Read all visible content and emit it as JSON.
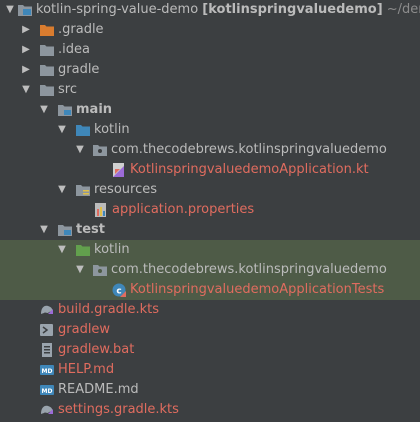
{
  "project": {
    "name": "kotlin-spring-value-demo",
    "module": "[kotlinspringvaluedemo]",
    "path": "~/demo/k"
  },
  "tree": {
    "gradle_dir": ".gradle",
    "idea_dir": ".idea",
    "gradle_folder": "gradle",
    "src": "src",
    "main": "main",
    "main_kotlin": "kotlin",
    "main_package": "com.thecodebrews.kotlinspringvaluedemo",
    "main_app_file": "KotlinspringvaluedemoApplication.kt",
    "resources": "resources",
    "application_properties": "application.properties",
    "test": "test",
    "test_kotlin": "kotlin",
    "test_package": "com.thecodebrews.kotlinspringvaluedemo",
    "test_file": "KotlinspringvaluedemoApplicationTests",
    "build_gradle": "build.gradle.kts",
    "gradlew": "gradlew",
    "gradlew_bat": "gradlew.bat",
    "help_md": "HELP.md",
    "readme_md": "README.md",
    "settings_gradle": "settings.gradle.kts"
  },
  "icon_names": {
    "folder": "folder-icon",
    "module": "module-folder-icon",
    "package": "package-icon",
    "kotlin_file": "kotlin-file-icon",
    "properties": "properties-file-icon",
    "gradle_script": "gradle-script-icon",
    "shell": "shell-script-icon",
    "batch": "batch-file-icon",
    "markdown": "markdown-file-icon"
  },
  "colors": {
    "background": "#3c3f41",
    "text": "#bbbbbb",
    "modified_text": "#e06c5f",
    "folder_gray": "#8d969e",
    "source_root_blue": "#3f87b9",
    "test_root_green": "#62a04d",
    "excluded_orange": "#d97c2f",
    "test_highlight": "#4e5b47"
  }
}
